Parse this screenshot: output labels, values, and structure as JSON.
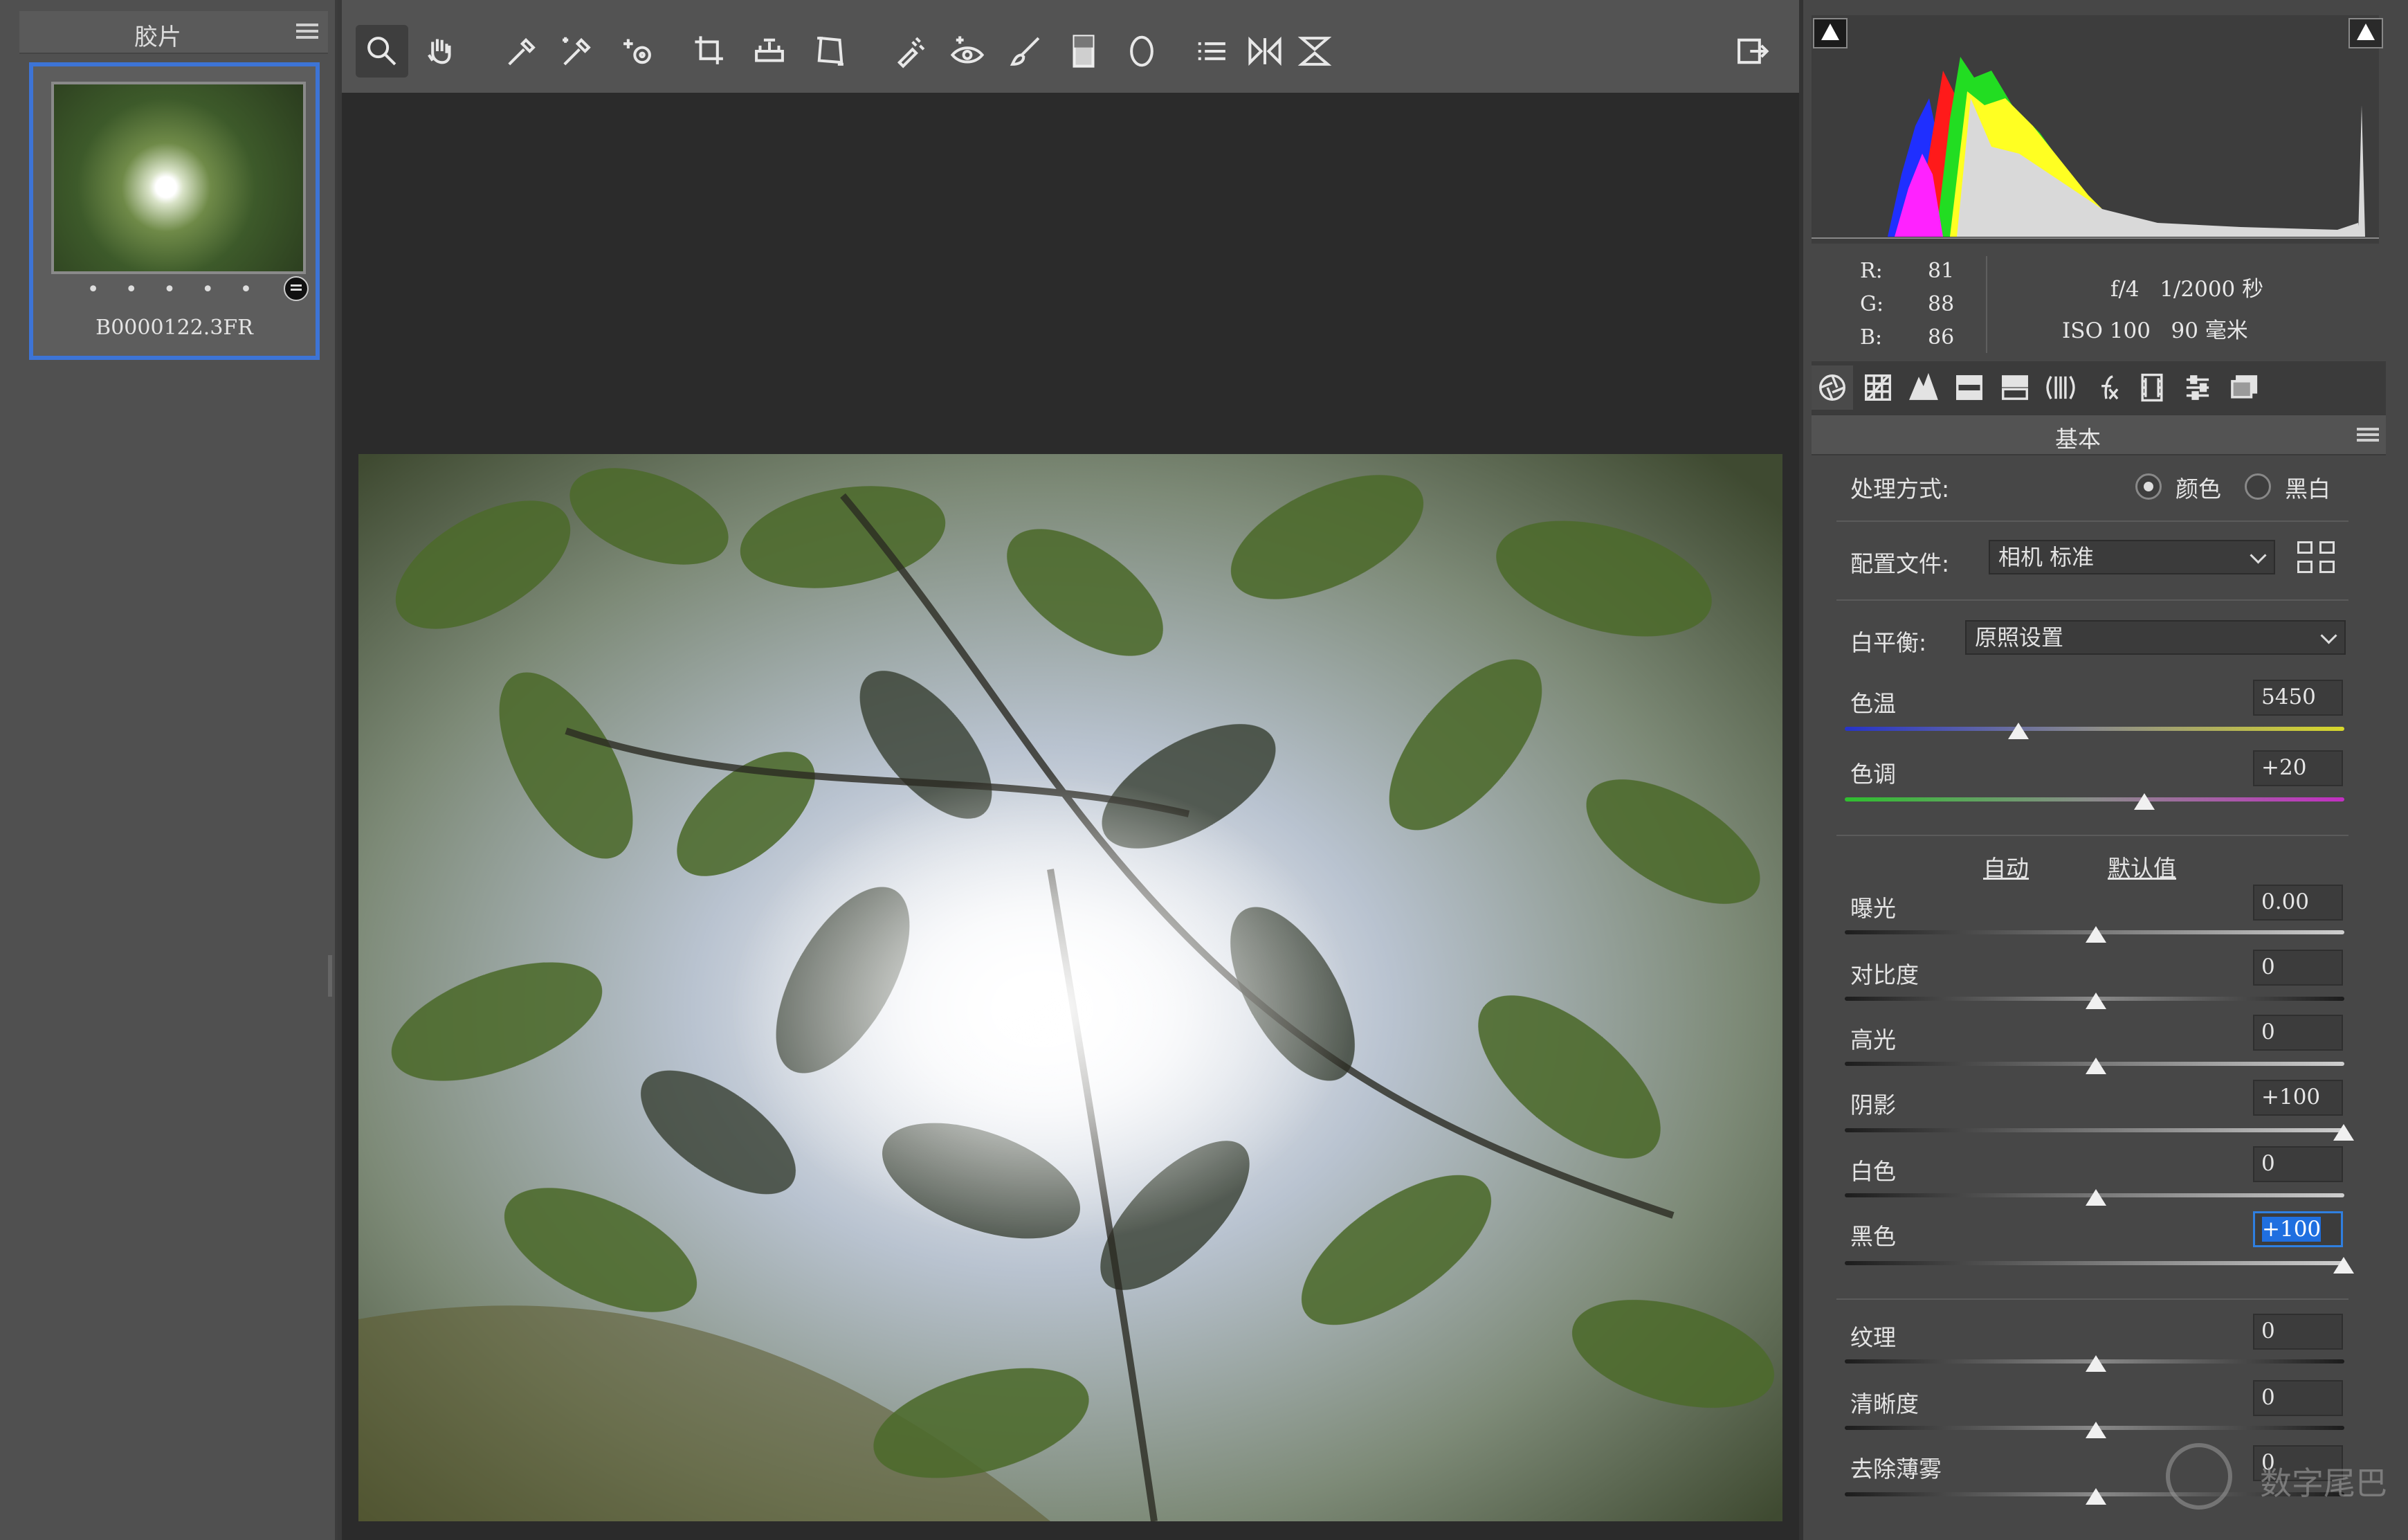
{
  "filmstrip": {
    "title": "胶片",
    "thumbnail": {
      "filename": "B0000122.3FR",
      "rating_dots": "• • • • •"
    }
  },
  "toolbar": {
    "tools": [
      "zoom-tool",
      "hand-tool",
      "white-balance-tool",
      "color-sampler-tool",
      "targeted-adjustment-tool",
      "crop-tool",
      "straighten-tool",
      "transform-tool",
      "spot-removal-tool",
      "red-eye-removal-tool",
      "adjustment-brush-tool",
      "graduated-filter-tool",
      "radial-filter-tool",
      "preferences-tool",
      "rotate-left-tool",
      "rotate-right-tool"
    ]
  },
  "readout": {
    "r_label": "R:",
    "r_value": "81",
    "g_label": "G:",
    "g_value": "88",
    "b_label": "B:",
    "b_value": "86",
    "camera_line1": "f/4   1/2000 秒",
    "camera_line2": "ISO 100   90 毫米"
  },
  "panel": {
    "section_title": "基本",
    "treatment": {
      "label": "处理方式:",
      "option_color": "颜色",
      "option_bw": "黑白",
      "selected": "颜色"
    },
    "profile": {
      "label": "配置文件:",
      "value": "相机 标准"
    },
    "white_balance": {
      "label": "白平衡:",
      "value": "原照设置"
    },
    "temp": {
      "label": "色温",
      "value": "5450"
    },
    "tint": {
      "label": "色调",
      "value": "+20"
    },
    "auto_label": "自动",
    "default_label": "默认值",
    "sliders": [
      {
        "label": "曝光",
        "value": "0.00"
      },
      {
        "label": "对比度",
        "value": "0"
      },
      {
        "label": "高光",
        "value": "0"
      },
      {
        "label": "阴影",
        "value": "+100"
      },
      {
        "label": "白色",
        "value": "0"
      },
      {
        "label": "黑色",
        "value": "+100"
      },
      {
        "label": "纹理",
        "value": "0"
      },
      {
        "label": "清晰度",
        "value": "0"
      },
      {
        "label": "去除薄雾",
        "value": "0"
      }
    ]
  },
  "watermark": {
    "text": "数字尾巴"
  },
  "colors": {
    "accent": "#3d74d6",
    "panel_bg": "#474747",
    "canvas_bg": "#2b2b2b"
  }
}
